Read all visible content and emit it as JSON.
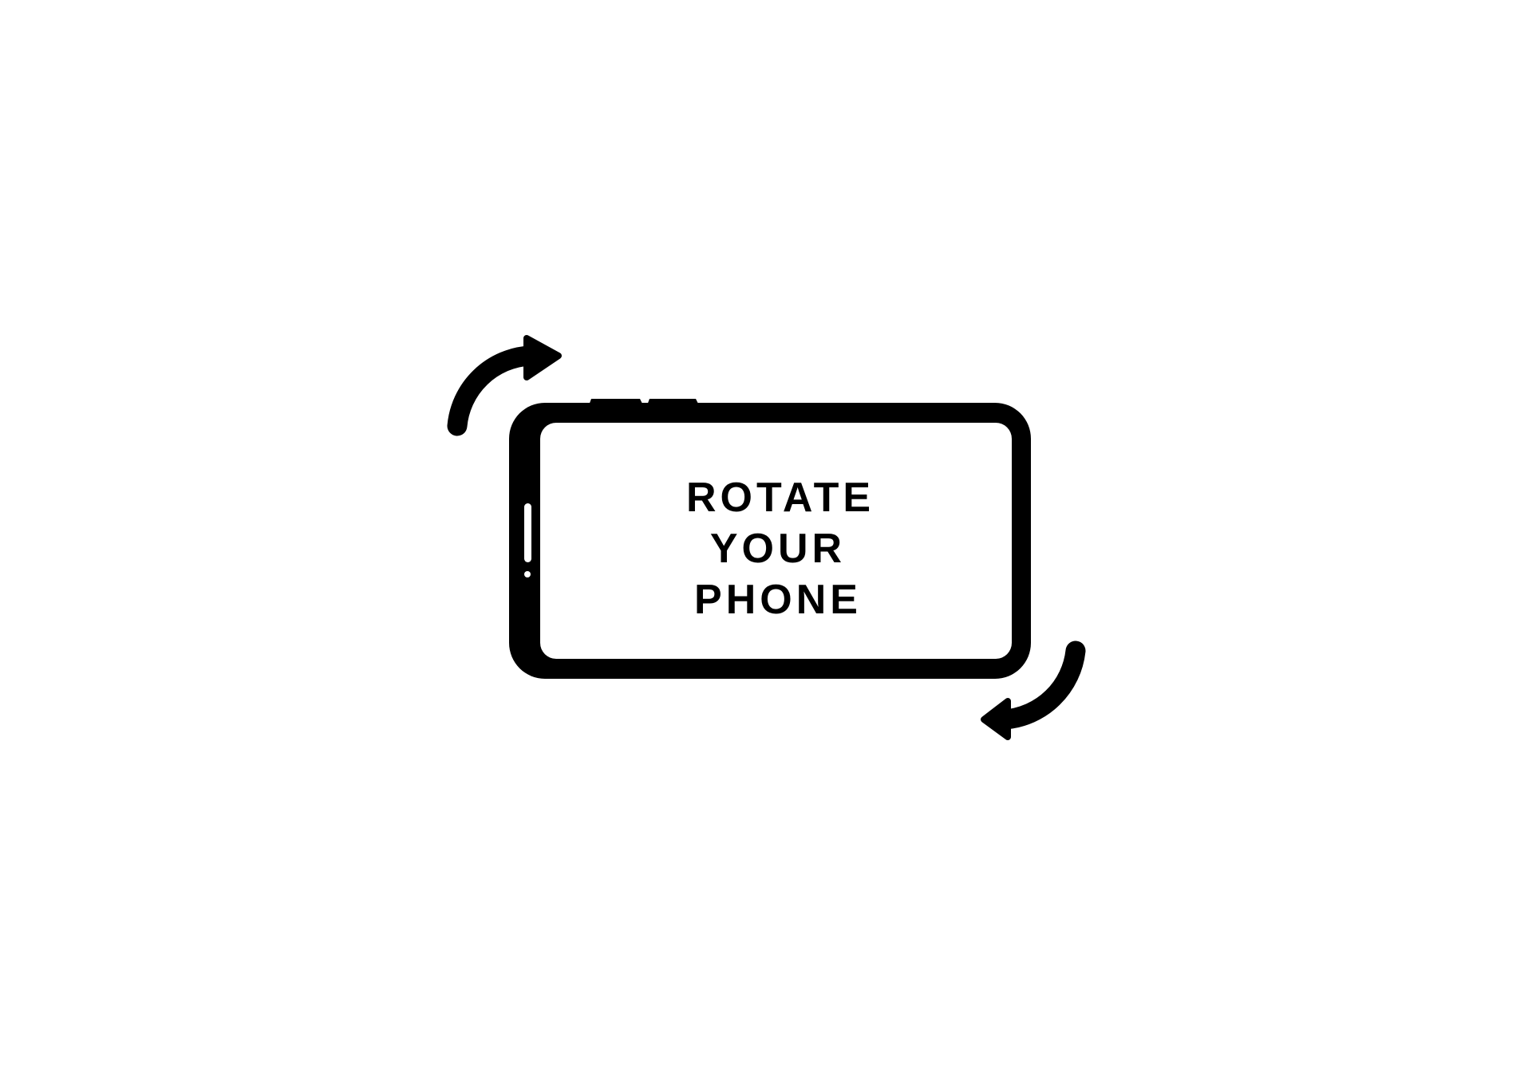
{
  "message": {
    "line1": "ROTATE",
    "line2": "YOUR",
    "line3": "PHONE"
  },
  "icons": {
    "phone": "landscape-phone-icon",
    "arrow_top": "rotate-arrow-clockwise-icon",
    "arrow_bottom": "rotate-arrow-counterclockwise-icon"
  },
  "colors": {
    "foreground": "#000000",
    "background": "#ffffff"
  }
}
